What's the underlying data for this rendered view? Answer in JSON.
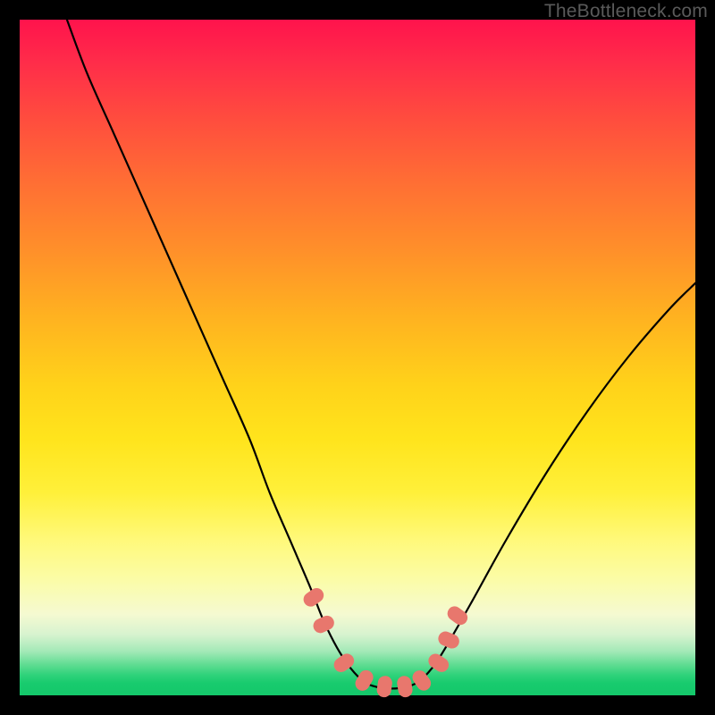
{
  "watermark": "TheBottleneck.com",
  "colors": {
    "curve_stroke": "#000000",
    "marker_fill": "#e8776d",
    "frame_bg": "#000000"
  },
  "chart_data": {
    "type": "line",
    "title": "",
    "xlabel": "",
    "ylabel": "",
    "xlim": [
      0,
      100
    ],
    "ylim": [
      0,
      100
    ],
    "grid": false,
    "legend": false,
    "series": [
      {
        "name": "bottleneck-curve",
        "x": [
          7,
          10,
          14,
          18,
          22,
          26,
          30,
          34,
          37,
          40,
          43,
          45,
          47,
          49,
          51,
          53,
          55,
          57,
          59,
          61,
          63,
          67,
          72,
          78,
          84,
          90,
          96,
          100
        ],
        "y": [
          100,
          92,
          83,
          74,
          65,
          56,
          47,
          38,
          30,
          23,
          16,
          11,
          7,
          4,
          2,
          1.2,
          1,
          1.2,
          2,
          4,
          7,
          14,
          23,
          33,
          42,
          50,
          57,
          61
        ]
      }
    ],
    "markers": {
      "name": "trough-markers",
      "x": [
        43.5,
        45.0,
        48.0,
        51.0,
        54.0,
        57.0,
        59.5,
        62.0,
        63.5,
        64.8
      ],
      "y": [
        14.5,
        10.5,
        4.8,
        2.2,
        1.3,
        1.3,
        2.2,
        4.8,
        8.2,
        11.8
      ]
    }
  }
}
